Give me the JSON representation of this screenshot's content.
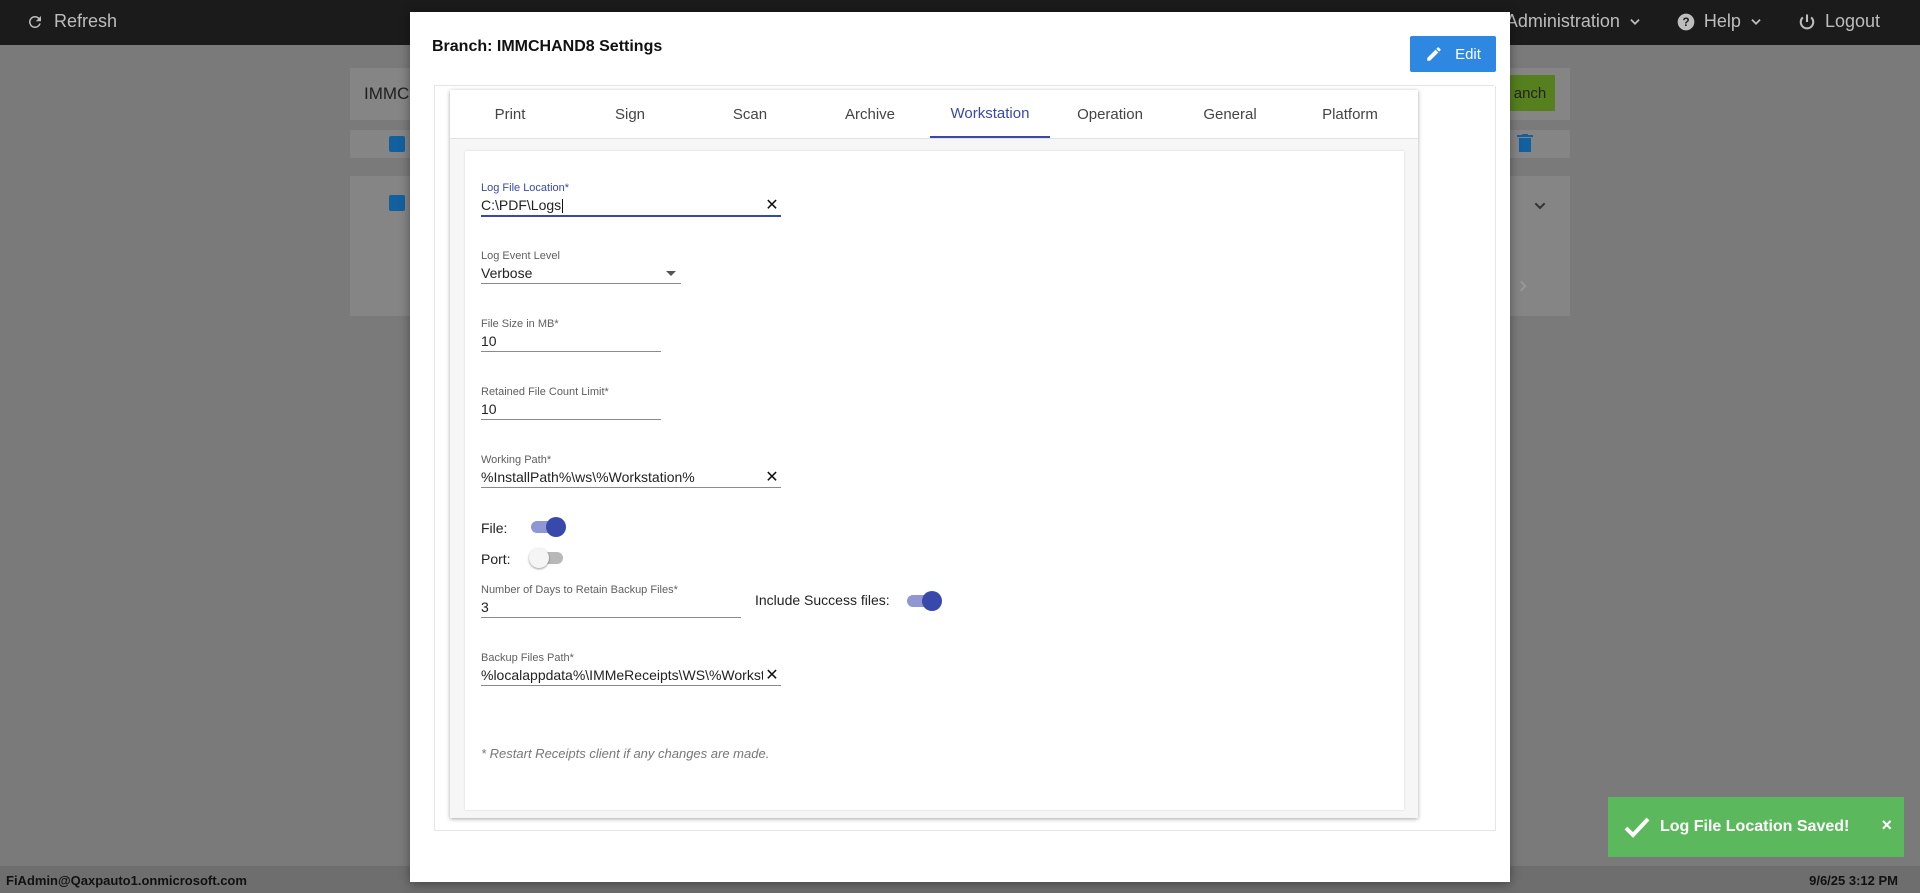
{
  "topbar": {
    "refresh_label": "Refresh",
    "administration_label": "Administration",
    "help_label": "Help",
    "logout_label": "Logout"
  },
  "background": {
    "search_value": "IMMC",
    "green_button_label": "anch"
  },
  "statusbar": {
    "user": "FiAdmin@Qaxpauto1.onmicrosoft.com",
    "timestamp": "9/6/25 3:12 PM"
  },
  "modal": {
    "title": "Branch: IMMCHAND8 Settings",
    "edit_label": "Edit",
    "tabs": [
      {
        "label": "Print"
      },
      {
        "label": "Sign"
      },
      {
        "label": "Scan"
      },
      {
        "label": "Archive"
      },
      {
        "label": "Workstation",
        "active": true
      },
      {
        "label": "Operation"
      },
      {
        "label": "General"
      },
      {
        "label": "Platform"
      }
    ],
    "fields": {
      "log_file_location": {
        "label": "Log File Location*",
        "value": "C:\\PDF\\Logs"
      },
      "log_event_level": {
        "label": "Log Event Level",
        "value": "Verbose"
      },
      "file_size_mb": {
        "label": "File Size in MB*",
        "value": "10"
      },
      "retained_file_count": {
        "label": "Retained File Count Limit*",
        "value": "10"
      },
      "working_path": {
        "label": "Working Path*",
        "value": "%InstallPath%\\ws\\%Workstation%"
      },
      "file_toggle": {
        "label": "File:",
        "on": true
      },
      "port_toggle": {
        "label": "Port:",
        "on": false
      },
      "days_retain_backup": {
        "label": "Number of Days to Retain Backup Files*",
        "value": "3"
      },
      "include_success": {
        "label": "Include Success files:",
        "on": true
      },
      "backup_files_path": {
        "label": "Backup Files Path*",
        "value": "%localappdata%\\IMMeReceipts\\WS\\%Workstation%"
      }
    },
    "note": "* Restart Receipts client if any changes are made."
  },
  "toast": {
    "message": "Log File Location Saved!",
    "close": "×"
  },
  "colors": {
    "accent": "#3949ab",
    "edit_button": "#2e87e0",
    "toast": "#5cb85c"
  }
}
